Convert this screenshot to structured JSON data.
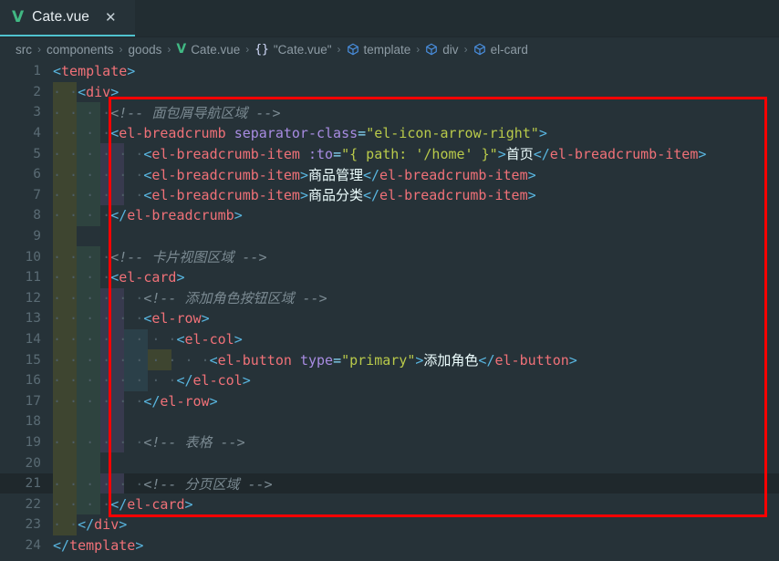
{
  "window": {
    "theme_bg": "#263238",
    "accent": "#4fc3cf",
    "annotation_color": "#fe0000"
  },
  "tab": {
    "icon": "vue-v-icon",
    "icon_glyph": "V",
    "label": "Cate.vue",
    "close_glyph": "✕"
  },
  "breadcrumb": {
    "items": [
      {
        "label": "src",
        "icon": ""
      },
      {
        "label": "components",
        "icon": ""
      },
      {
        "label": "goods",
        "icon": ""
      },
      {
        "label": "Cate.vue",
        "icon": "vue-v-icon",
        "icon_glyph": "V"
      },
      {
        "label": "\"Cate.vue\"",
        "icon": "braces-icon",
        "icon_glyph": "{}"
      },
      {
        "label": "template",
        "icon": "cube-icon"
      },
      {
        "label": "div",
        "icon": "cube-icon"
      },
      {
        "label": "el-card",
        "icon": "cube-icon"
      }
    ],
    "separator": "›"
  },
  "editor": {
    "language": "vue",
    "current_line": 21,
    "lines": [
      {
        "n": 1,
        "indent": 0,
        "guides": []
      },
      {
        "n": 2,
        "indent": 1,
        "guides": [
          0
        ]
      },
      {
        "n": 3,
        "indent": 2,
        "guides": [
          0,
          1
        ]
      },
      {
        "n": 4,
        "indent": 2,
        "guides": [
          0,
          1
        ]
      },
      {
        "n": 5,
        "indent": 3,
        "guides": [
          0,
          1,
          2
        ]
      },
      {
        "n": 6,
        "indent": 3,
        "guides": [
          0,
          1,
          2
        ]
      },
      {
        "n": 7,
        "indent": 3,
        "guides": [
          0,
          1,
          2
        ]
      },
      {
        "n": 8,
        "indent": 2,
        "guides": [
          0,
          1
        ]
      },
      {
        "n": 9,
        "indent": 0,
        "guides": [
          0
        ]
      },
      {
        "n": 10,
        "indent": 2,
        "guides": [
          0,
          1
        ]
      },
      {
        "n": 11,
        "indent": 2,
        "guides": [
          0,
          1
        ]
      },
      {
        "n": 12,
        "indent": 3,
        "guides": [
          0,
          1,
          2
        ]
      },
      {
        "n": 13,
        "indent": 3,
        "guides": [
          0,
          1,
          2
        ]
      },
      {
        "n": 14,
        "indent": 4,
        "guides": [
          0,
          1,
          2,
          3
        ]
      },
      {
        "n": 15,
        "indent": 5,
        "guides": [
          0,
          1,
          2,
          3,
          4
        ]
      },
      {
        "n": 16,
        "indent": 4,
        "guides": [
          0,
          1,
          2,
          3
        ]
      },
      {
        "n": 17,
        "indent": 3,
        "guides": [
          0,
          1,
          2
        ]
      },
      {
        "n": 18,
        "indent": 0,
        "guides": [
          0,
          1,
          2
        ]
      },
      {
        "n": 19,
        "indent": 3,
        "guides": [
          0,
          1,
          2
        ]
      },
      {
        "n": 20,
        "indent": 0,
        "guides": [
          0,
          1
        ]
      },
      {
        "n": 21,
        "indent": 3,
        "guides": [
          0,
          1,
          2
        ]
      },
      {
        "n": 22,
        "indent": 2,
        "guides": [
          0,
          1
        ]
      },
      {
        "n": 23,
        "indent": 1,
        "guides": [
          0
        ]
      },
      {
        "n": 24,
        "indent": 0,
        "guides": []
      }
    ],
    "code_text": {
      "l1": "<template>",
      "l2": "  <div>",
      "l3": "    <!-- 面包屑导航区域 -->",
      "l4": "    <el-breadcrumb separator-class=\"el-icon-arrow-right\">",
      "l5": "      <el-breadcrumb-item :to=\"{ path: '/home' }\">首页</el-breadcrumb-item>",
      "l6": "      <el-breadcrumb-item>商品管理</el-breadcrumb-item>",
      "l7": "      <el-breadcrumb-item>商品分类</el-breadcrumb-item>",
      "l8": "    </el-breadcrumb>",
      "l9": "",
      "l10": "    <!-- 卡片视图区域 -->",
      "l11": "    <el-card>",
      "l12": "      <!-- 添加角色按钮区域 -->",
      "l13": "      <el-row>",
      "l14": "        <el-col>",
      "l15": "          <el-button type=\"primary\">添加角色</el-button>",
      "l16": "        </el-col>",
      "l17": "      </el-row>",
      "l18": "",
      "l19": "      <!-- 表格 -->",
      "l20": "",
      "l21": "      <!-- 分页区域 -->",
      "l22": "    </el-card>",
      "l23": "  </div>",
      "l24": "</template>"
    },
    "tokens": {
      "comment_3": "<!-- 面包屑导航区域 -->",
      "comment_10": "<!-- 卡片视图区域 -->",
      "comment_12": "<!-- 添加角色按钮区域 -->",
      "comment_19": "<!-- 表格 -->",
      "comment_21": "<!-- 分页区域 -->",
      "tag_template": "template",
      "tag_div": "div",
      "tag_breadcrumb": "el-breadcrumb",
      "tag_breadcrumb_item": "el-breadcrumb-item",
      "tag_card": "el-card",
      "tag_row": "el-row",
      "tag_col": "el-col",
      "tag_button": "el-button",
      "attr_separator_class": "separator-class",
      "attr_to": ":to",
      "attr_type": "type",
      "str_arrow_right": "\"el-icon-arrow-right\"",
      "str_to_value": "\"{ path: '/home' }\"",
      "str_primary": "\"primary\"",
      "text_home": "首页",
      "text_goods_mgmt": "商品管理",
      "text_goods_cat": "商品分类",
      "text_add_role": "添加角色"
    }
  }
}
